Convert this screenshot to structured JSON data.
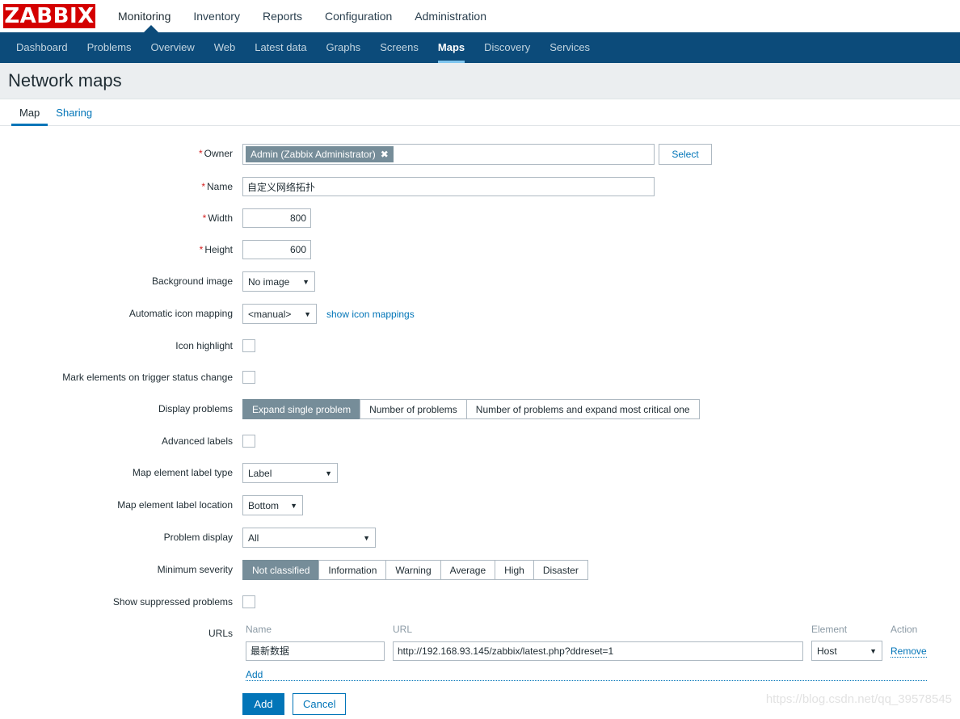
{
  "brand": {
    "logo_text": "ZABBIX",
    "logo_color": "#d40000"
  },
  "main_nav": {
    "items": [
      {
        "label": "Monitoring",
        "active": true
      },
      {
        "label": "Inventory",
        "active": false
      },
      {
        "label": "Reports",
        "active": false
      },
      {
        "label": "Configuration",
        "active": false
      },
      {
        "label": "Administration",
        "active": false
      }
    ]
  },
  "sub_nav": {
    "bg_color": "#0c4b7a",
    "items": [
      {
        "label": "Dashboard",
        "active": false
      },
      {
        "label": "Problems",
        "active": false
      },
      {
        "label": "Overview",
        "active": false
      },
      {
        "label": "Web",
        "active": false
      },
      {
        "label": "Latest data",
        "active": false
      },
      {
        "label": "Graphs",
        "active": false
      },
      {
        "label": "Screens",
        "active": false
      },
      {
        "label": "Maps",
        "active": true
      },
      {
        "label": "Discovery",
        "active": false
      },
      {
        "label": "Services",
        "active": false
      }
    ]
  },
  "page": {
    "title": "Network maps"
  },
  "form_tabs": [
    {
      "label": "Map",
      "active": true
    },
    {
      "label": "Sharing",
      "active": false
    }
  ],
  "form": {
    "owner": {
      "label": "Owner",
      "required": true,
      "chip_text": "Admin (Zabbix Administrator)",
      "chip_remove_icon": "close-icon",
      "chip_color": "#768d99",
      "select_button": "Select"
    },
    "name": {
      "label": "Name",
      "required": true,
      "value": "自定义网络拓扑",
      "placeholder": ""
    },
    "width": {
      "label": "Width",
      "required": true,
      "value": "800"
    },
    "height": {
      "label": "Height",
      "required": true,
      "value": "600"
    },
    "background_image": {
      "label": "Background image",
      "value": "No image",
      "options": [
        "No image"
      ]
    },
    "automatic_icon_mapping": {
      "label": "Automatic icon mapping",
      "value": "<manual>",
      "options": [
        "<manual>"
      ],
      "link": "show icon mappings"
    },
    "icon_highlight": {
      "label": "Icon highlight",
      "checked": false
    },
    "mark_elements": {
      "label": "Mark elements on trigger status change",
      "checked": false
    },
    "display_problems": {
      "label": "Display problems",
      "options": [
        "Expand single problem",
        "Number of problems",
        "Number of problems and expand most critical one"
      ],
      "selected": "Expand single problem"
    },
    "advanced_labels": {
      "label": "Advanced labels",
      "checked": false
    },
    "map_element_label_type": {
      "label": "Map element label type",
      "value": "Label",
      "options": [
        "Label"
      ]
    },
    "map_element_label_location": {
      "label": "Map element label location",
      "value": "Bottom",
      "options": [
        "Bottom"
      ]
    },
    "problem_display": {
      "label": "Problem display",
      "value": "All",
      "options": [
        "All"
      ]
    },
    "minimum_severity": {
      "label": "Minimum severity",
      "options": [
        "Not classified",
        "Information",
        "Warning",
        "Average",
        "High",
        "Disaster"
      ],
      "selected": "Not classified"
    },
    "show_suppressed": {
      "label": "Show suppressed problems",
      "checked": false
    },
    "urls": {
      "label": "URLs",
      "columns": [
        "Name",
        "URL",
        "Element",
        "Action"
      ],
      "rows": [
        {
          "name": "最新数据",
          "url": "http://192.168.93.145/zabbix/latest.php?ddreset=1",
          "element": "Host",
          "action": "Remove"
        }
      ],
      "add_label": "Add"
    }
  },
  "footer": {
    "submit_label": "Add",
    "cancel_label": "Cancel"
  },
  "watermark": {
    "text": "https://blog.csdn.net/qq_39578545"
  }
}
